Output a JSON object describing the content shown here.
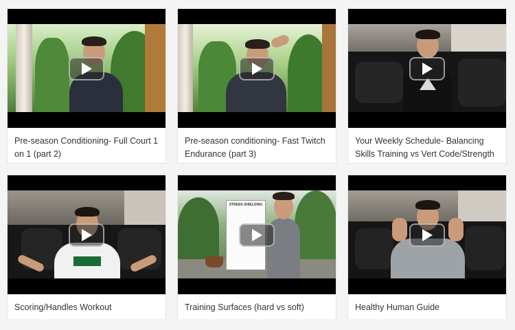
{
  "videos": [
    {
      "title": "Pre-season Conditioning- Full Court 1 on 1 (part 2)"
    },
    {
      "title": "Pre-season conditioning- Fast Twitch Endurance (part 3)"
    },
    {
      "title": "Your Weekly Schedule- Balancing Skills Training vs Vert Code/Strength"
    },
    {
      "title": "Scoring/Handles Workout"
    },
    {
      "title": "Training Surfaces (hard vs soft)"
    },
    {
      "title": "Healthy Human Guide"
    }
  ],
  "play_icon": "play-icon",
  "whiteboard_text": "STRESS SHIELDING",
  "colors": {
    "card_bg": "#ffffff",
    "page_bg": "#f4f4f4",
    "title_text": "#333333",
    "thumb_letterbox": "#000000"
  }
}
